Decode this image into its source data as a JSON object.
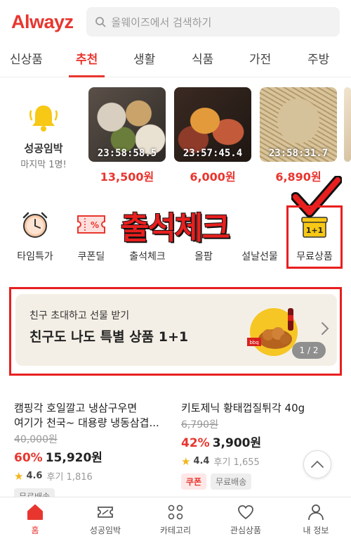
{
  "header": {
    "logo": "Alwayz",
    "search_placeholder": "올웨이즈에서 검색하기"
  },
  "tabs": [
    {
      "label": "신상품"
    },
    {
      "label": "추천",
      "active": true
    },
    {
      "label": "생활"
    },
    {
      "label": "식품"
    },
    {
      "label": "가전"
    },
    {
      "label": "주방"
    }
  ],
  "success_deal": {
    "title": "성공임박",
    "subtitle": "마지막 1명!"
  },
  "deals": [
    {
      "timer": "23:58:58.5",
      "price": "13,500원"
    },
    {
      "timer": "23:57:45.4",
      "price": "6,000원"
    },
    {
      "timer": "23:58:31.7",
      "price": "6,890원"
    }
  ],
  "quick_menu": [
    {
      "label": "타임특가",
      "icon": "alarm-clock-icon"
    },
    {
      "label": "쿠폰딜",
      "icon": "coupon-icon"
    },
    {
      "label": "출석체크",
      "icon": "attendance-icon"
    },
    {
      "label": "올팜",
      "icon": "farm-icon"
    },
    {
      "label": "설날선물",
      "icon": "gift-icon"
    },
    {
      "label": "무료상품",
      "icon": "free-gift-box-icon"
    }
  ],
  "overlay_annotation": "출석체크",
  "banner": {
    "subtitle": "친구 초대하고 선물 받기",
    "title": "친구도 나도 특별 상품 1+1",
    "pager": "1 / 2"
  },
  "products": [
    {
      "name_line1": "캠핑각 호일깔고 냉삼구우면",
      "name_line2": "여기가 천국~ 대용량 냉동삼겹...",
      "original_price": "40,000원",
      "discount": "60%",
      "price": "15,920원",
      "score": "4.6",
      "reviews": "후기 1,816",
      "badges": [
        "무료배송"
      ]
    },
    {
      "name_line1": "키토제닉 황태껍질튀각 40g",
      "original_price": "6,790원",
      "discount": "42%",
      "price": "3,900원",
      "score": "4.4",
      "reviews": "후기 1,655",
      "badges": [
        "쿠폰",
        "무료배송"
      ]
    }
  ],
  "bottom_nav": [
    {
      "label": "홈",
      "icon": "home-icon",
      "active": true
    },
    {
      "label": "성공임박",
      "icon": "ticket-icon"
    },
    {
      "label": "카테고리",
      "icon": "category-grid-icon"
    },
    {
      "label": "관심상품",
      "icon": "heart-icon"
    },
    {
      "label": "내 정보",
      "icon": "profile-icon"
    }
  ],
  "colors": {
    "brand": "#e8362f",
    "annotation_red": "#e81f1f"
  }
}
